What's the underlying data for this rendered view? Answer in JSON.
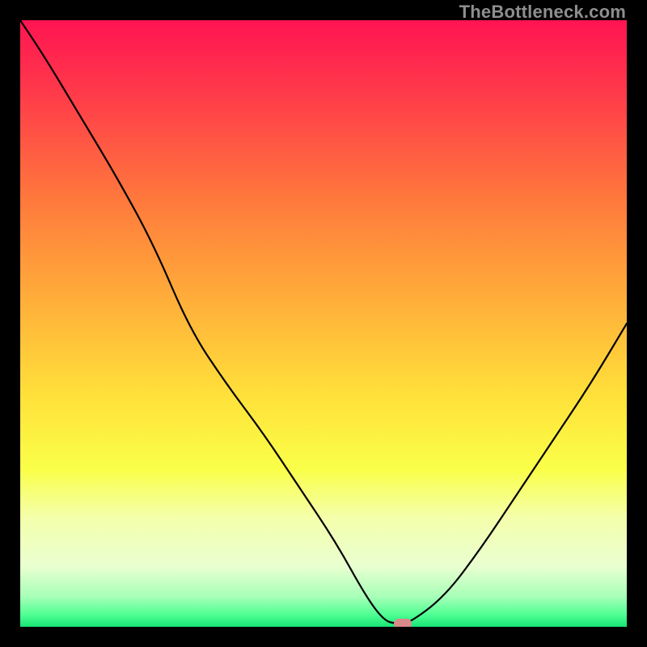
{
  "watermark": "TheBottleneck.com",
  "colors": {
    "frame_bg": "#000000",
    "marker": "#d98a8a",
    "curve": "#000000",
    "gradient_stops": [
      {
        "pct": 0,
        "color": "#ff1452"
      },
      {
        "pct": 12,
        "color": "#ff3a4a"
      },
      {
        "pct": 30,
        "color": "#ff7a3c"
      },
      {
        "pct": 48,
        "color": "#ffb43a"
      },
      {
        "pct": 62,
        "color": "#ffe13a"
      },
      {
        "pct": 74,
        "color": "#faff48"
      },
      {
        "pct": 82,
        "color": "#f4ffab"
      },
      {
        "pct": 90,
        "color": "#e9ffd0"
      },
      {
        "pct": 95,
        "color": "#a8ffb8"
      },
      {
        "pct": 98,
        "color": "#4fff94"
      },
      {
        "pct": 100,
        "color": "#18e574"
      }
    ]
  },
  "chart_data": {
    "type": "line",
    "title": "",
    "xlabel": "",
    "ylabel": "",
    "x": [
      0,
      4,
      10,
      16,
      22,
      28,
      34,
      40,
      46,
      52,
      57,
      60,
      62,
      64,
      70,
      76,
      82,
      88,
      94,
      100
    ],
    "values": [
      100,
      94,
      84,
      74,
      63,
      49,
      40,
      32,
      23,
      14,
      5,
      1,
      0.5,
      0.5,
      5,
      13,
      22,
      31,
      40,
      50
    ],
    "xlim": [
      0,
      100
    ],
    "ylim": [
      0,
      100
    ],
    "marker": {
      "x": 63,
      "y": 0.5
    },
    "annotations": []
  }
}
